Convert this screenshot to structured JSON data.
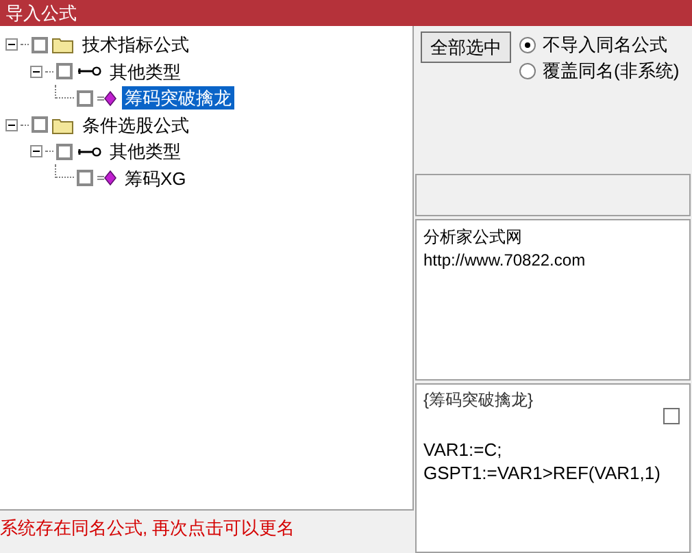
{
  "window": {
    "title": "导入公式"
  },
  "tree": [
    {
      "label": "技术指标公式",
      "kind": "folder",
      "checked": false,
      "expanded": true,
      "selected": false,
      "children": [
        {
          "label": "其他类型",
          "kind": "category",
          "checked": false,
          "expanded": true,
          "selected": false,
          "children": [
            {
              "label": "筹码突破擒龙",
              "kind": "formula",
              "checked": false,
              "selected": true
            }
          ]
        }
      ]
    },
    {
      "label": "条件选股公式",
      "kind": "folder",
      "checked": false,
      "expanded": true,
      "selected": false,
      "children": [
        {
          "label": "其他类型",
          "kind": "category",
          "checked": false,
          "expanded": true,
          "selected": false,
          "children": [
            {
              "label": "筹码XG",
              "kind": "formula",
              "checked": false,
              "selected": false
            }
          ]
        }
      ]
    }
  ],
  "select_all_button": "全部选中",
  "radios": [
    {
      "label": "不导入同名公式",
      "selected": true
    },
    {
      "label": "覆盖同名(非系统)",
      "selected": false
    }
  ],
  "info": {
    "lines": [
      "分析家公式网",
      "http://www.70822.com"
    ]
  },
  "formula": {
    "title": "{筹码突破擒龙}",
    "checked": false,
    "lines": [
      "VAR1:=C;",
      "GSPT1:=VAR1>REF(VAR1,1)"
    ]
  },
  "status_bar": "系统存在同名公式, 再次点击可以更名"
}
